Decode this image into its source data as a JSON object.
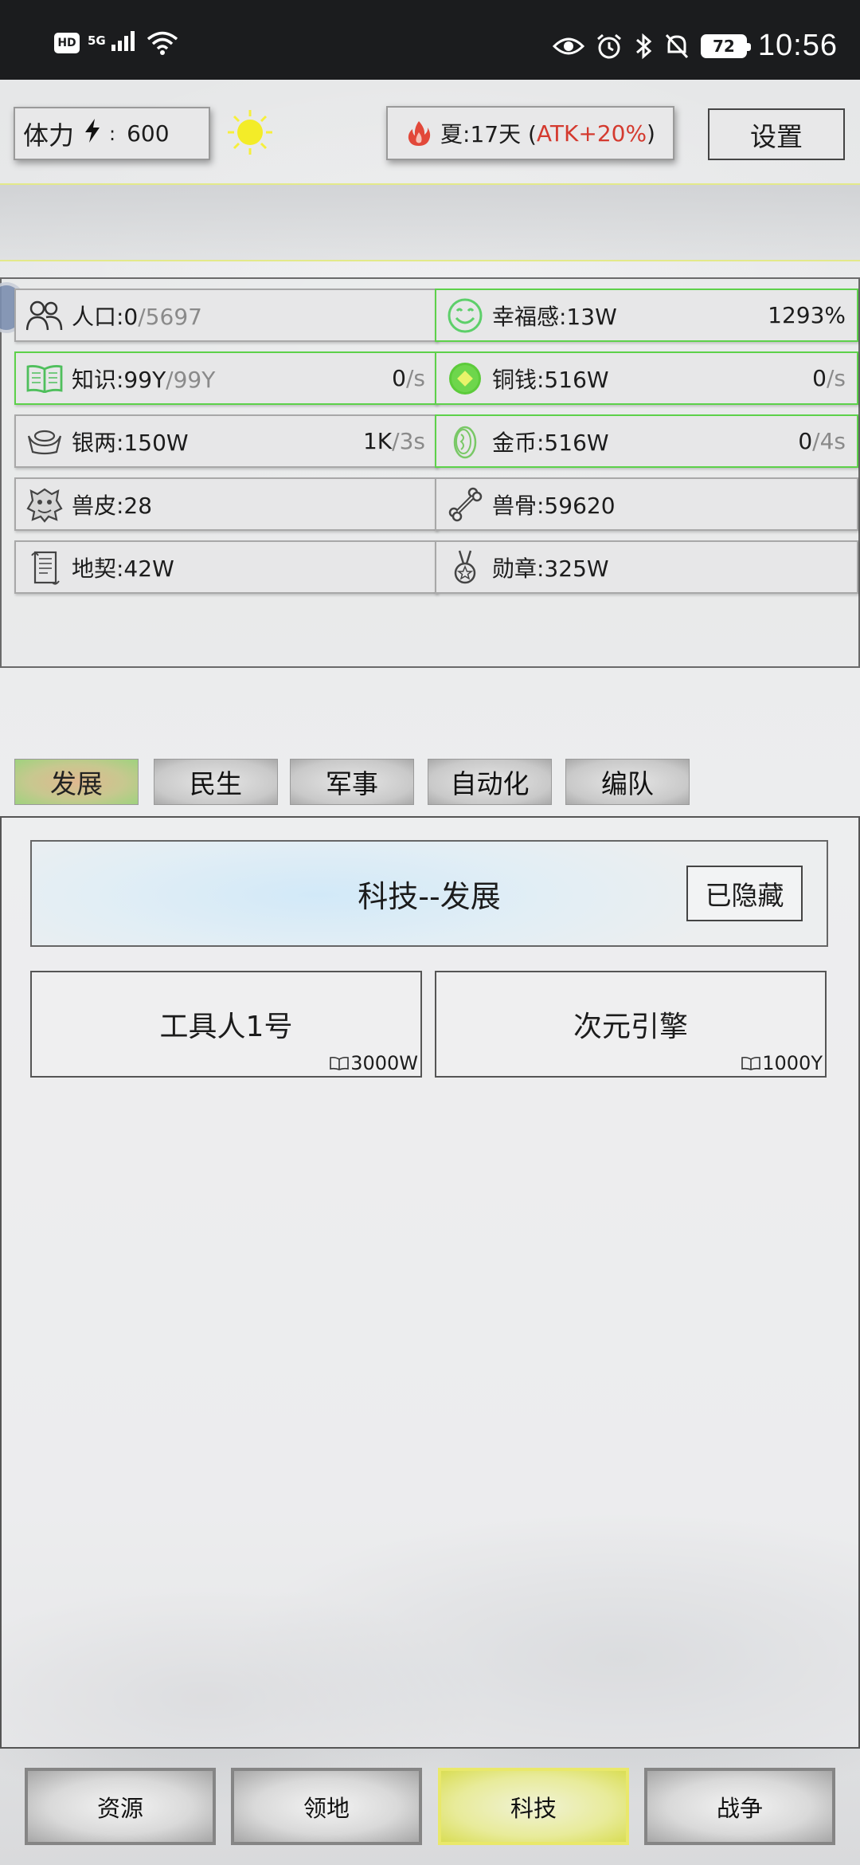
{
  "status_bar": {
    "left_icons": [
      "hd-icon",
      "5g-signal-icon",
      "wifi-icon"
    ],
    "hd": "HD",
    "network": "5G",
    "right_icons": [
      "eye-icon",
      "alarm-icon",
      "bluetooth-icon",
      "mute-bell-icon",
      "battery-icon"
    ],
    "battery": "72",
    "time": "10:56"
  },
  "top": {
    "stamina_label": "体力",
    "stamina_sep": ":",
    "stamina_value": "600",
    "weather_icon": "sun-icon",
    "season_main": "夏:17天 (",
    "season_bonus": "ATK+20%",
    "season_close": ")",
    "settings_label": "设置"
  },
  "resources": [
    {
      "icon": "people-icon",
      "name": "人口:0",
      "extra": "/5697",
      "rate_value": "",
      "rate_unit": "",
      "highlight": false
    },
    {
      "icon": "smile-icon",
      "name": "幸福感:13W",
      "extra": "",
      "rate_value": "1293%",
      "rate_unit": "",
      "highlight": true
    },
    {
      "icon": "book-icon",
      "name": "知识:99Y",
      "extra": "/99Y",
      "rate_value": "0",
      "rate_unit": "/s",
      "highlight": true
    },
    {
      "icon": "coin-icon",
      "name": "铜钱:516W",
      "extra": "",
      "rate_value": "0",
      "rate_unit": "/s",
      "highlight": true
    },
    {
      "icon": "silver-ingot-icon",
      "name": "银两:150W",
      "extra": "",
      "rate_value": "1K",
      "rate_unit": "/3s",
      "highlight": false
    },
    {
      "icon": "gold-coin-icon",
      "name": "金币:516W",
      "extra": "",
      "rate_value": "0",
      "rate_unit": "/4s",
      "highlight": true
    },
    {
      "icon": "hide-icon",
      "name": "兽皮:28",
      "extra": "",
      "rate_value": "",
      "rate_unit": "",
      "highlight": false
    },
    {
      "icon": "bone-icon",
      "name": "兽骨:59620",
      "extra": "",
      "rate_value": "",
      "rate_unit": "",
      "highlight": false
    },
    {
      "icon": "scroll-icon",
      "name": "地契:42W",
      "extra": "",
      "rate_value": "",
      "rate_unit": "",
      "highlight": false
    },
    {
      "icon": "medal-icon",
      "name": "勋章:325W",
      "extra": "",
      "rate_value": "",
      "rate_unit": "",
      "highlight": false
    }
  ],
  "tabs": {
    "items": [
      "发展",
      "民生",
      "军事",
      "自动化",
      "编队"
    ],
    "active": "发展"
  },
  "tech": {
    "header_title": "科技--发展",
    "hidden_button": "已隐藏",
    "cards": [
      {
        "name": "工具人1号",
        "cost": "3000W",
        "cost_icon": "book-icon"
      },
      {
        "name": "次元引擎",
        "cost": "1000Y",
        "cost_icon": "book-icon"
      }
    ]
  },
  "bottom_nav": {
    "items": [
      "资源",
      "领地",
      "科技",
      "战争"
    ],
    "active": "科技"
  },
  "colors": {
    "highlight_border": "#5dd14a",
    "season_bonus": "#d43a2f",
    "active_tab": "#9fd27e",
    "active_bottom": "#e9e86a"
  }
}
